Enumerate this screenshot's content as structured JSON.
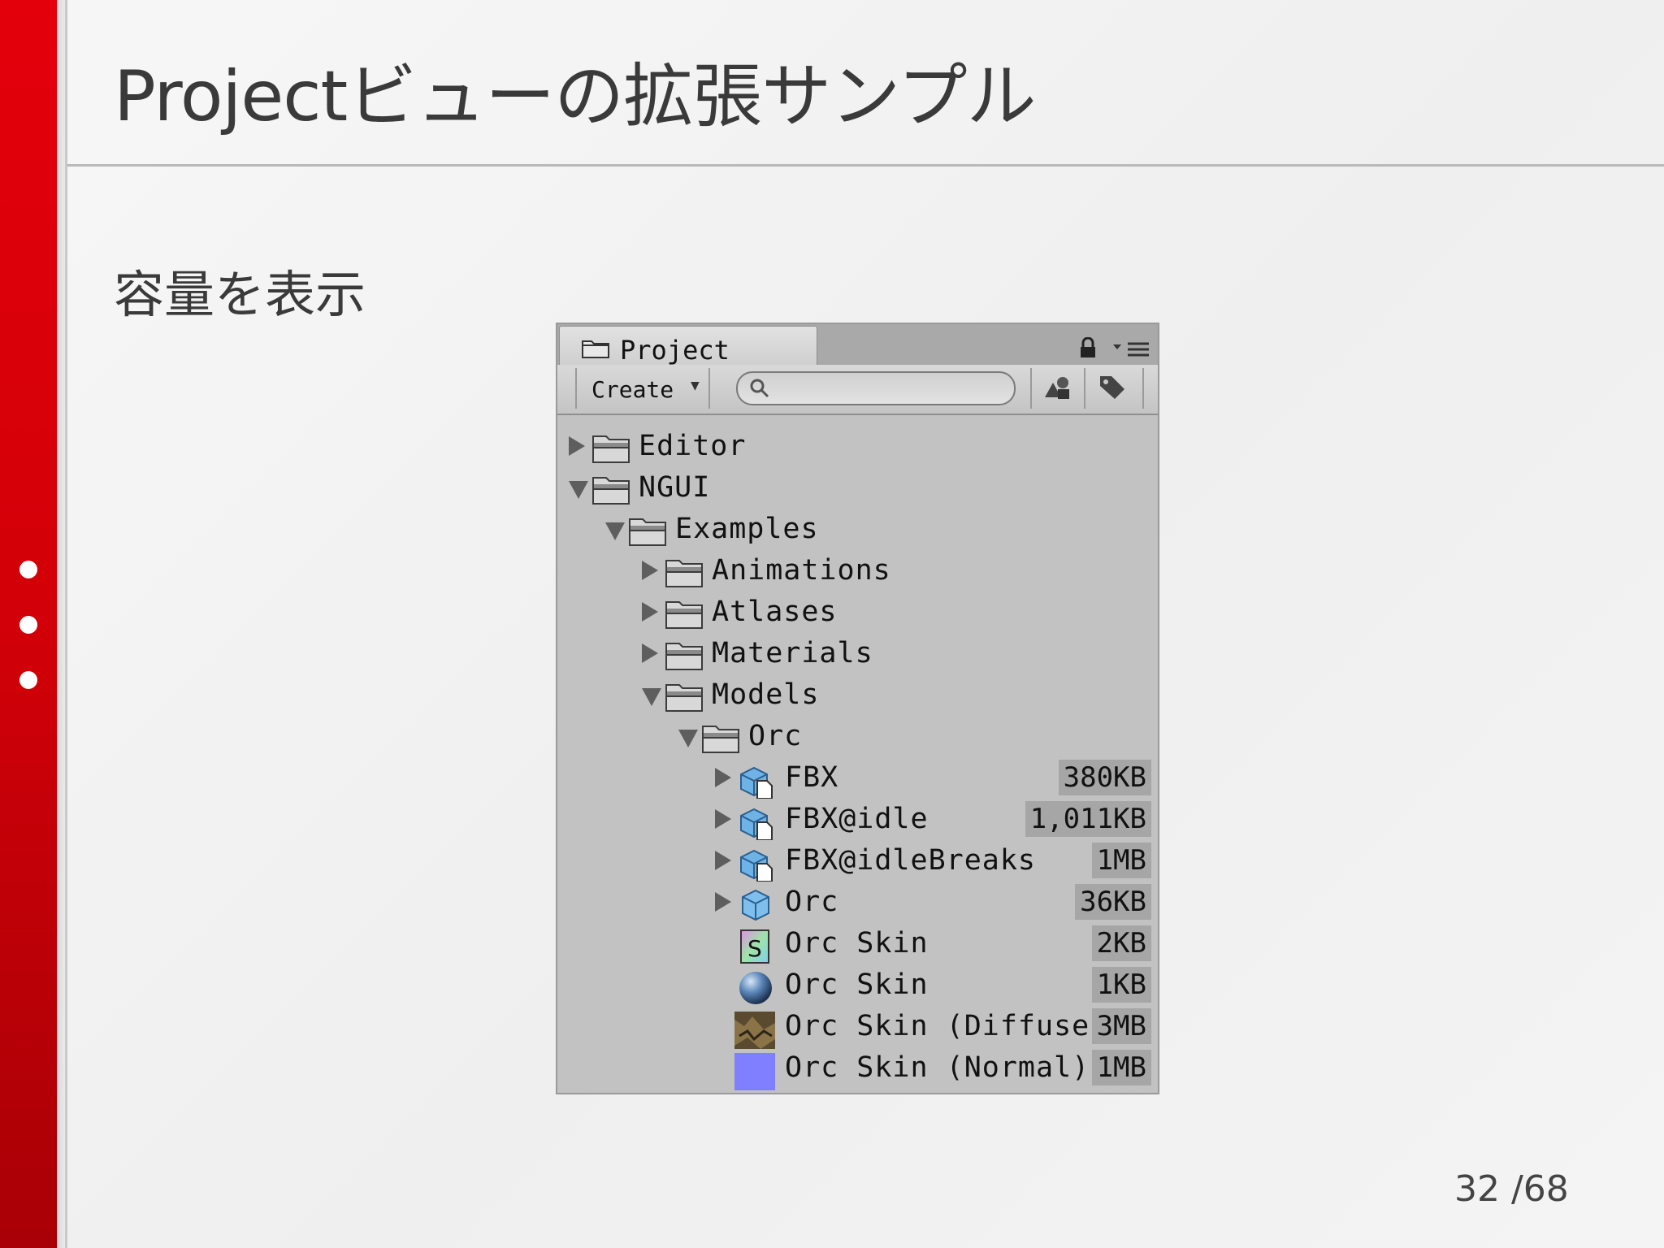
{
  "slide": {
    "title": "Projectビューの拡張サンプル",
    "subtitle": "容量を表示",
    "page_number": "32 /68"
  },
  "project_window": {
    "tab_label": "Project",
    "create_label": "Create",
    "search_placeholder": "",
    "tree": [
      {
        "label": "Editor",
        "depth": 0,
        "expanded": false,
        "icon": "folder-icon",
        "size": ""
      },
      {
        "label": "NGUI",
        "depth": 0,
        "expanded": true,
        "icon": "folder-icon",
        "size": ""
      },
      {
        "label": "Examples",
        "depth": 1,
        "expanded": true,
        "icon": "folder-icon",
        "size": ""
      },
      {
        "label": "Animations",
        "depth": 2,
        "expanded": false,
        "icon": "folder-icon",
        "size": ""
      },
      {
        "label": "Atlases",
        "depth": 2,
        "expanded": false,
        "icon": "folder-icon",
        "size": ""
      },
      {
        "label": "Materials",
        "depth": 2,
        "expanded": false,
        "icon": "folder-icon",
        "size": ""
      },
      {
        "label": "Models",
        "depth": 2,
        "expanded": true,
        "icon": "folder-icon",
        "size": ""
      },
      {
        "label": "Orc",
        "depth": 3,
        "expanded": true,
        "icon": "folder-icon",
        "size": ""
      },
      {
        "label": "FBX",
        "depth": 4,
        "expanded": false,
        "icon": "model-file-icon",
        "size": "380KB"
      },
      {
        "label": "FBX@idle",
        "depth": 4,
        "expanded": false,
        "icon": "model-file-icon",
        "size": "1,011KB"
      },
      {
        "label": "FBX@idleBreaks",
        "depth": 4,
        "expanded": false,
        "icon": "model-file-icon",
        "size": "1MB"
      },
      {
        "label": "Orc",
        "depth": 4,
        "expanded": false,
        "icon": "prefab-cube-icon",
        "size": "36KB"
      },
      {
        "label": "Orc Skin",
        "depth": 4,
        "expanded": null,
        "icon": "shader-icon",
        "size": "2KB"
      },
      {
        "label": "Orc Skin",
        "depth": 4,
        "expanded": null,
        "icon": "material-sphere-icon",
        "size": "1KB"
      },
      {
        "label": "Orc Skin (Diffuse)",
        "depth": 4,
        "expanded": null,
        "icon": "diffuse-texture-icon",
        "size": "3MB"
      },
      {
        "label": "Orc Skin (Normal)",
        "depth": 4,
        "expanded": null,
        "icon": "normal-texture-icon",
        "size": "1MB"
      }
    ]
  },
  "colors": {
    "accent_red": "#e3000b",
    "window_bg": "#c2c2c2",
    "size_badge_bg": "#a6a6a6",
    "normal_map_blue": "#7f7fff"
  }
}
